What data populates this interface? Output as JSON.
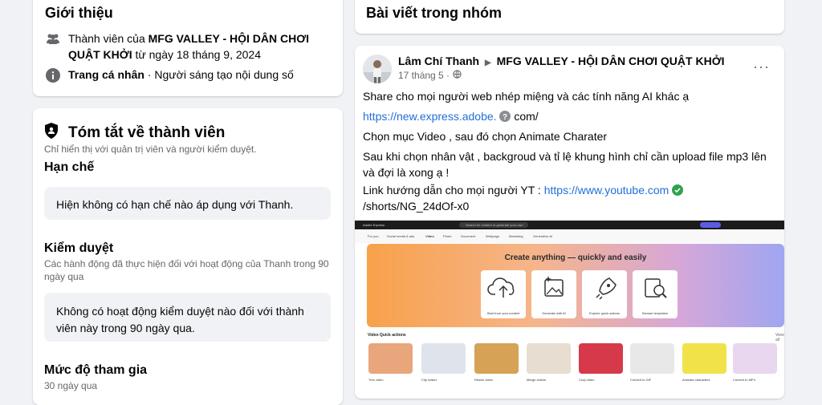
{
  "intro": {
    "title": "Giới thiệu",
    "member_prefix": "Thành viên của ",
    "group_name": "MFG VALLEY - HỘI DÂN CHƠI QUẬT KHỞI",
    "member_since": " từ ngày 18 tháng 9, 2024",
    "profile_label": "Trang cá nhân",
    "profile_desc": " · Người sáng tạo nội dung số"
  },
  "summary": {
    "title": "Tóm tắt về thành viên",
    "subtitle": "Chỉ hiển thị với quản trị viên và người kiểm duyệt.",
    "restrictions_heading": "Hạn chế",
    "restrictions_text": "Hiện không có hạn chế nào áp dụng với Thanh.",
    "moderation_heading": "Kiểm duyệt",
    "moderation_sub": "Các hành động đã thực hiện đối với hoạt động của Thanh trong 90 ngày qua",
    "moderation_text": "Không có hoạt động kiểm duyệt nào đối với thành viên này trong 90 ngày qua.",
    "participation_heading": "Mức độ tham gia",
    "participation_sub": "30 ngày qua"
  },
  "posts": {
    "header": "Bài viết trong nhóm"
  },
  "post": {
    "author": "Lâm Chí Thanh",
    "group": "MFG VALLEY - HỘI DÂN CHƠI QUẬT KHỞI",
    "date": "17 tháng 5 ·",
    "more": "···",
    "line1": "Share cho mọi người web nhép miệng và các tính năng AI khác ạ",
    "link1": "https://new.express.adobe.",
    "link1_suffix": "com/",
    "line3": "Chọn mục Video , sau đó chọn Animate Charater",
    "line4": "Sau khi chọn nhân vật  , backgroud và tỉ lệ khung hình chỉ cần upload file mp3 lên và đợi là xong ạ !",
    "line5_prefix": "Link hướng dẫn cho mọi người YT : ",
    "link2": "https://www.youtube.com",
    "link2_suffix": "/shorts/NG_24dOf-x0"
  },
  "screenshot": {
    "brand": "Adobe Express",
    "search_placeholder": "Search for content or generate your own",
    "tabs": [
      "For you",
      "Social media & ads",
      "Video",
      "Photo",
      "Document",
      "Webpage",
      "Marketing",
      "Generative AI"
    ],
    "banner_title": "Create anything — quickly and easily",
    "tiles": [
      "Start from your content",
      "Generate with AI",
      "Explore quick actions",
      "Browse templates"
    ],
    "quick_actions_title": "Video Quick actions",
    "view_all": "View all",
    "thumbs": [
      "Trim video",
      "Clip maker",
      "Resize video",
      "Merge videos",
      "Crop video",
      "Convert to GIF",
      "Animate characters",
      "Convert to MP4"
    ]
  }
}
